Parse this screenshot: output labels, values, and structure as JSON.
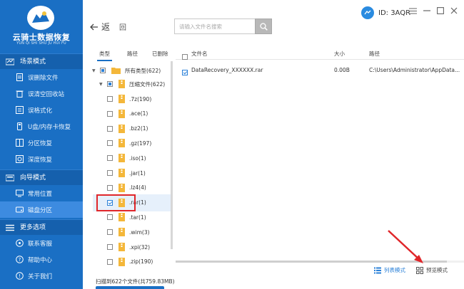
{
  "app": {
    "name": "云骑士数据恢复",
    "subtitle": "YUN QI SHI SHU JU HUI FU",
    "user_id": "ID: 3AQR"
  },
  "sidebar": {
    "sections": [
      {
        "label": "场景模式",
        "items": [
          "误删除文件",
          "误清空回收站",
          "误格式化",
          "U盘/内存卡恢复",
          "分区恢复",
          "深度恢复"
        ]
      },
      {
        "label": "向导模式",
        "items": [
          "常用位置",
          "磁盘分区"
        ]
      },
      {
        "label": "更多选项",
        "items": [
          "联系客服",
          "帮助中心",
          "关于我们"
        ]
      }
    ],
    "active_item": "磁盘分区"
  },
  "toolbar": {
    "back_label": "返",
    "refresh_label": "回",
    "search_placeholder": "请输入文件名搜索"
  },
  "tree": {
    "tabs": [
      "类型",
      "路径",
      "已删除"
    ],
    "root": {
      "label": "所有类型(622)"
    },
    "group": {
      "label": "压缩文件(622)"
    },
    "items": [
      ".7z(190)",
      ".ace(1)",
      ".bz2(1)",
      ".gz(197)",
      ".iso(1)",
      ".jar(1)",
      ".lz4(4)",
      ".rar(1)",
      ".tar(1)",
      ".wim(3)",
      ".xpi(32)",
      ".zip(190)"
    ],
    "checked_item": ".rar(1)"
  },
  "filelist": {
    "columns": {
      "name": "文件名",
      "size": "大小",
      "path": "路径"
    },
    "rows": [
      {
        "name": "DataRecovery_XXXXXX.rar",
        "size": "0.00B",
        "path": "C:\\Users\\Administrator\\AppData..."
      }
    ]
  },
  "footer": {
    "status": "扫描到622个文件(共759.83MB)",
    "list_mode": "列表模式",
    "preview_mode": "预览模式"
  },
  "colors": {
    "sidebar": "#1a6fc4",
    "accent": "#2a80d8",
    "highlight": "#e0262a"
  }
}
